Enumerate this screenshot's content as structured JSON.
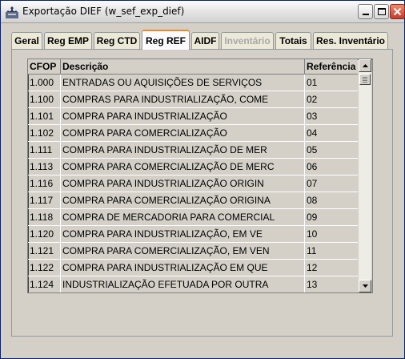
{
  "window": {
    "title": "Exportação DIEF (w_sef_exp_dief)"
  },
  "tabs": [
    {
      "label": "Geral",
      "state": "normal"
    },
    {
      "label": "Reg EMP",
      "state": "normal"
    },
    {
      "label": "Reg CTD",
      "state": "normal"
    },
    {
      "label": "Reg REF",
      "state": "active"
    },
    {
      "label": "AIDF",
      "state": "normal"
    },
    {
      "label": "Inventário",
      "state": "disabled"
    },
    {
      "label": "Totais",
      "state": "normal"
    },
    {
      "label": "Res. Inventário",
      "state": "normal"
    }
  ],
  "grid": {
    "columns": [
      "CFOP",
      "Descrição",
      "Referência"
    ],
    "rows": [
      [
        "1.000",
        "ENTRADAS OU AQUISIÇÕES DE SERVIÇOS",
        "01"
      ],
      [
        "1.100",
        "COMPRAS PARA INDUSTRIALIZAÇÃO, COME",
        "02"
      ],
      [
        "1.101",
        "COMPRA PARA INDUSTRIALIZAÇÃO",
        "03"
      ],
      [
        "1.102",
        "COMPRA PARA COMERCIALIZAÇÃO",
        "04"
      ],
      [
        "1.111",
        "COMPRA PARA INDUSTRIALIZAÇÃO DE MER",
        "05"
      ],
      [
        "1.113",
        "COMPRA PARA COMERCIALIZAÇÃO DE MERC",
        "06"
      ],
      [
        "1.116",
        "COMPRA PARA INDUSTRIALIZAÇÃO ORIGIN",
        "07"
      ],
      [
        "1.117",
        "COMPRA PARA COMERCIALIZAÇÃO ORIGINA",
        "08"
      ],
      [
        "1.118",
        "COMPRA DE MERCADORIA PARA COMERCIAL",
        "09"
      ],
      [
        "1.120",
        "COMPRA PARA INDUSTRIALIZAÇÃO, EM VE",
        "10"
      ],
      [
        "1.121",
        "COMPRA PARA COMERCIALIZAÇÃO, EM VEN",
        "11"
      ],
      [
        "1.122",
        "COMPRA PARA INDUSTRIALIZAÇÃO EM QUE",
        "12"
      ],
      [
        "1.124",
        "INDUSTRIALIZAÇÃO EFETUADA POR OUTRA",
        "13"
      ]
    ]
  },
  "icons": {
    "app": "app-icon",
    "minimize": "minimize-icon",
    "maximize": "maximize-icon",
    "close": "close-icon",
    "scroll_up": "scroll-up-arrow-icon",
    "scroll_down": "scroll-down-arrow-icon"
  },
  "colors": {
    "active_tab_accent": "#e68b2c",
    "close_button": "#c8392b",
    "disabled_text": "#a8a8a8"
  }
}
